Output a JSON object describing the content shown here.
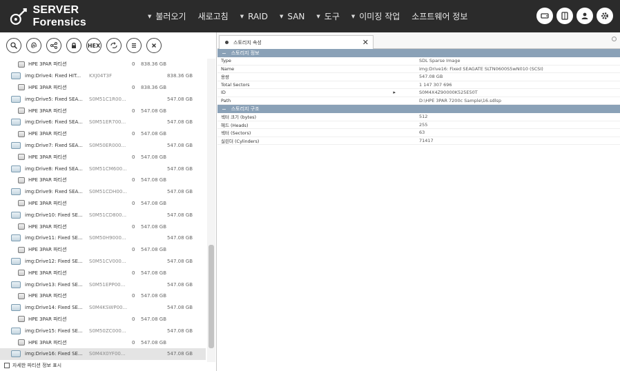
{
  "app": {
    "title": "SERVER Forensics",
    "menu": [
      "불러오기",
      "새로고침",
      "RAID",
      "SAN",
      "도구",
      "이미징 작업",
      "소프트웨어 정보"
    ],
    "menu_arrows": [
      true,
      false,
      true,
      true,
      true,
      true,
      false
    ],
    "top_icons": [
      "drive-icon",
      "book-icon",
      "user-icon",
      "gear-icon"
    ]
  },
  "toolbar": {
    "hex_label": "HEX",
    "icons": [
      "search-icon",
      "fingerprint-icon",
      "share-icon",
      "lock-icon",
      "hex-icon",
      "export-icon",
      "list-icon",
      "close-icon"
    ]
  },
  "tree": {
    "rows": [
      {
        "kind": "part",
        "name": "HPE 3PAR 파티션",
        "serial": "",
        "part": "0",
        "size": "838.36 GB"
      },
      {
        "kind": "drive",
        "name": "img:Drive4: Fixed HIT...",
        "serial": "KXJ04T3F",
        "part": "",
        "size": "838.36 GB"
      },
      {
        "kind": "part",
        "name": "HPE 3PAR 파티션",
        "serial": "",
        "part": "0",
        "size": "838.36 GB"
      },
      {
        "kind": "drive",
        "name": "img:Drive5: Fixed SEA...",
        "serial": "S0M51C1R00...",
        "part": "",
        "size": "547.08 GB"
      },
      {
        "kind": "part",
        "name": "HPE 3PAR 파티션",
        "serial": "",
        "part": "0",
        "size": "547.08 GB"
      },
      {
        "kind": "drive",
        "name": "img:Drive6: Fixed SEA...",
        "serial": "S0M51ER700...",
        "part": "",
        "size": "547.08 GB"
      },
      {
        "kind": "part",
        "name": "HPE 3PAR 파티션",
        "serial": "",
        "part": "0",
        "size": "547.08 GB"
      },
      {
        "kind": "drive",
        "name": "img:Drive7: Fixed SEA...",
        "serial": "S0M50ER000...",
        "part": "",
        "size": "547.08 GB"
      },
      {
        "kind": "part",
        "name": "HPE 3PAR 파티션",
        "serial": "",
        "part": "0",
        "size": "547.08 GB"
      },
      {
        "kind": "drive",
        "name": "img:Drive8: Fixed SEA...",
        "serial": "S0M51CM600...",
        "part": "",
        "size": "547.08 GB"
      },
      {
        "kind": "part",
        "name": "HPE 3PAR 파티션",
        "serial": "",
        "part": "0",
        "size": "547.08 GB"
      },
      {
        "kind": "drive",
        "name": "img:Drive9: Fixed SEA...",
        "serial": "S0M51CDH00...",
        "part": "",
        "size": "547.08 GB"
      },
      {
        "kind": "part",
        "name": "HPE 3PAR 파티션",
        "serial": "",
        "part": "0",
        "size": "547.08 GB"
      },
      {
        "kind": "drive",
        "name": "img:Drive10: Fixed SE...",
        "serial": "S0M51CD800...",
        "part": "",
        "size": "547.08 GB"
      },
      {
        "kind": "part",
        "name": "HPE 3PAR 파티션",
        "serial": "",
        "part": "0",
        "size": "547.08 GB"
      },
      {
        "kind": "drive",
        "name": "img:Drive11: Fixed SE...",
        "serial": "S0M50H9000...",
        "part": "",
        "size": "547.08 GB"
      },
      {
        "kind": "part",
        "name": "HPE 3PAR 파티션",
        "serial": "",
        "part": "0",
        "size": "547.08 GB"
      },
      {
        "kind": "drive",
        "name": "img:Drive12: Fixed SE...",
        "serial": "S0M51CV000...",
        "part": "",
        "size": "547.08 GB"
      },
      {
        "kind": "part",
        "name": "HPE 3PAR 파티션",
        "serial": "",
        "part": "0",
        "size": "547.08 GB"
      },
      {
        "kind": "drive",
        "name": "img:Drive13: Fixed SE...",
        "serial": "S0M51EPP00...",
        "part": "",
        "size": "547.08 GB"
      },
      {
        "kind": "part",
        "name": "HPE 3PAR 파티션",
        "serial": "",
        "part": "0",
        "size": "547.08 GB"
      },
      {
        "kind": "drive",
        "name": "img:Drive14: Fixed SE...",
        "serial": "S0M4KSWP00...",
        "part": "",
        "size": "547.08 GB"
      },
      {
        "kind": "part",
        "name": "HPE 3PAR 파티션",
        "serial": "",
        "part": "0",
        "size": "547.08 GB"
      },
      {
        "kind": "drive",
        "name": "img:Drive15: Fixed SE...",
        "serial": "S0M50ZC000...",
        "part": "",
        "size": "547.08 GB"
      },
      {
        "kind": "part",
        "name": "HPE 3PAR 파티션",
        "serial": "",
        "part": "0",
        "size": "547.08 GB"
      },
      {
        "kind": "drive",
        "name": "img:Drive16: Fixed SE...",
        "serial": "S0M4X0YF00...",
        "part": "",
        "size": "547.08 GB",
        "selected": true
      }
    ],
    "footer_checkbox": "자세한 파티션 정보 표시"
  },
  "detail": {
    "tab_label": "스토리지 속성",
    "sections": [
      {
        "title": "스토리지 정보",
        "props": [
          {
            "k": "Type",
            "v": "SDL Sparse Image"
          },
          {
            "k": "Name",
            "v": "img:Drive16: Fixed SEAGATE SLTN0600S5wN010 (SCSI)"
          },
          {
            "k": "용량",
            "v": "547.08 GB"
          },
          {
            "k": "Total Sectors",
            "v": "1 147 307 696"
          },
          {
            "k": "ID",
            "v": "S0M4X4Z90000K525E50T",
            "mark": "▸"
          },
          {
            "k": "Path",
            "v": "D:\\HPE 3PAR 7200c Sample\\16.sdlsp"
          }
        ]
      },
      {
        "title": "스토리지 구조",
        "props": [
          {
            "k": "섹터 크기 (bytes)",
            "v": "512"
          },
          {
            "k": "헤드 (Heads)",
            "v": "255"
          },
          {
            "k": "섹터 (Sectors)",
            "v": "63"
          },
          {
            "k": "실린더 (Cylinders)",
            "v": "71417"
          }
        ]
      }
    ]
  }
}
